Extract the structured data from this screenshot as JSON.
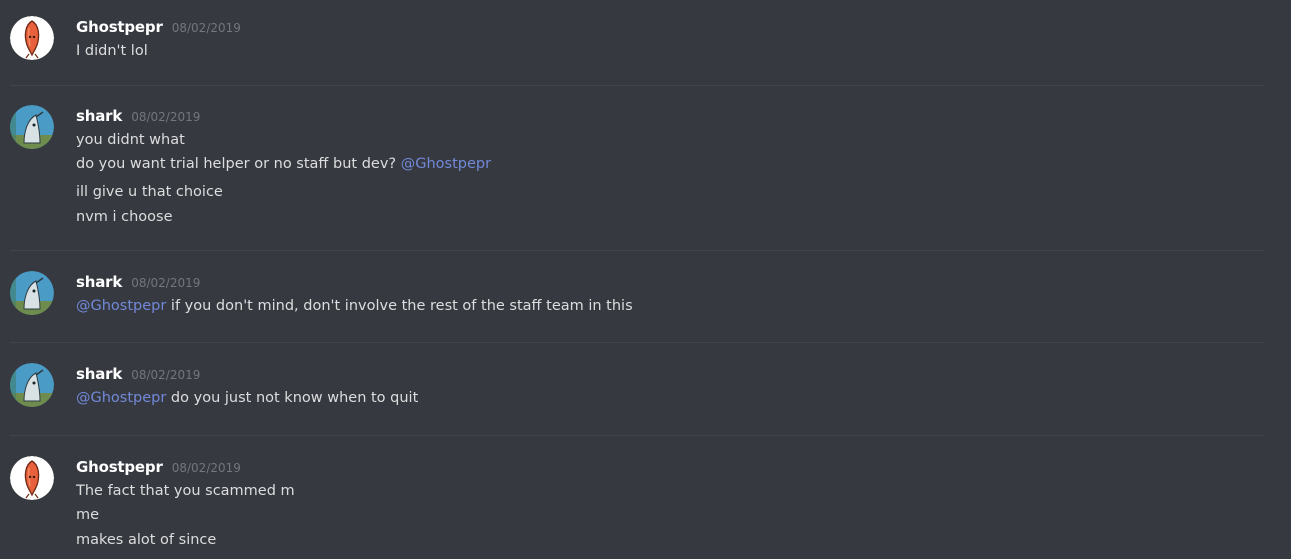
{
  "messages": [
    {
      "author": "Ghostpepr",
      "avatar": "pepper-avatar",
      "timestamp": "08/02/2019",
      "lines": [
        {
          "text": "I didn't lol"
        }
      ]
    },
    {
      "author": "shark",
      "avatar": "shark-avatar",
      "timestamp": "08/02/2019",
      "lines": [
        {
          "text": "you didnt what"
        },
        {
          "text": "do you want trial helper or no staff but dev? ",
          "mention": "@Ghostpepr",
          "highlighted": true
        },
        {
          "text": "ill give u that choice"
        },
        {
          "text": "nvm i choose"
        }
      ]
    },
    {
      "author": "shark",
      "avatar": "shark-avatar",
      "timestamp": "08/02/2019",
      "lines": [
        {
          "mention": "@Ghostpepr",
          "text": " if you don't mind, don't involve the rest of the staff team in this",
          "highlighted": true
        }
      ]
    },
    {
      "author": "shark",
      "avatar": "shark-avatar",
      "timestamp": "08/02/2019",
      "lines": [
        {
          "mention": "@Ghostpepr",
          "text": " do you just not know when to quit",
          "highlighted": true
        }
      ]
    },
    {
      "author": "Ghostpepr",
      "avatar": "pepper-avatar",
      "timestamp": "08/02/2019",
      "lines": [
        {
          "text": "The fact that you scammed m"
        },
        {
          "text": "me"
        },
        {
          "text": "makes alot of since"
        }
      ]
    }
  ],
  "colors": {
    "background": "#36393f",
    "mention": "#7289da",
    "highlight": "#49443c",
    "highlight_bar": "#faa61a"
  }
}
